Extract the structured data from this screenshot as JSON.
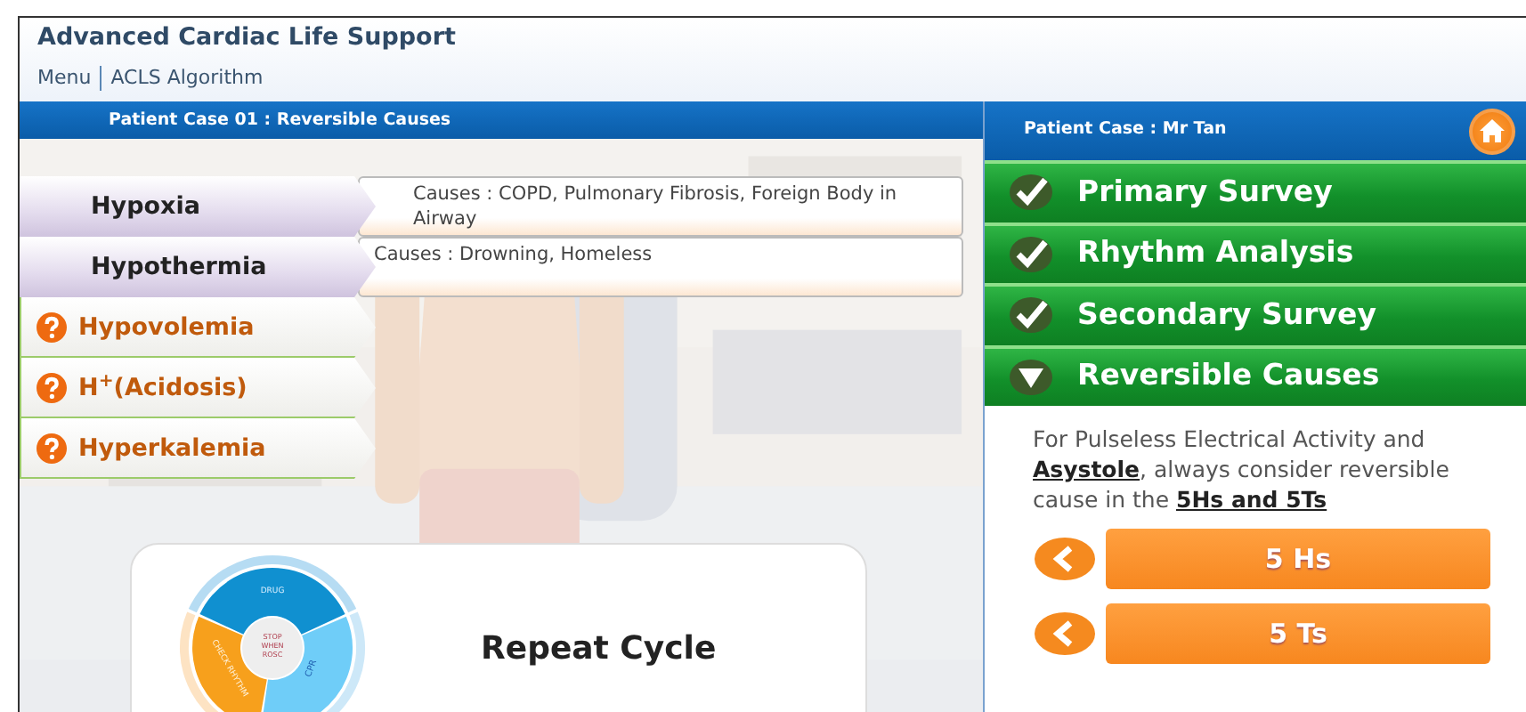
{
  "app": {
    "title": "Advanced Cardiac Life Support",
    "breadcrumb": [
      "Menu",
      "ACLS Algorithm"
    ]
  },
  "case_panel": {
    "title": "Patient Case 01 : Reversible Causes",
    "causes": [
      {
        "label": "Hypoxia",
        "revealed": true,
        "detail": "Causes : COPD, Pulmonary Fibrosis, Foreign Body in Airway"
      },
      {
        "label": "Hypothermia",
        "revealed": true,
        "detail": "Causes : Drowning, Homeless"
      },
      {
        "label": "Hypovolemia",
        "revealed": false
      },
      {
        "label": "H$^{+}$(Acidosis)",
        "revealed": false
      },
      {
        "label": "Hyperkalemia",
        "revealed": false
      }
    ],
    "cycle_card": {
      "title": "Repeat Cycle",
      "diagram_labels": [
        "DRUG",
        "STOP WHEN ROSC",
        "CHECK RHYTHM",
        "CPR"
      ]
    }
  },
  "side_panel": {
    "title": "Patient Case : Mr Tan",
    "steps": [
      {
        "label": "Primary Survey",
        "completed": true,
        "expanded": false
      },
      {
        "label": "Rhythm Analysis",
        "completed": true,
        "expanded": false
      },
      {
        "label": "Secondary Survey",
        "completed": true,
        "expanded": false
      },
      {
        "label": "Reversible Causes",
        "completed": false,
        "expanded": true
      }
    ],
    "note": "For Pulseless Electrical Activity and **Asystole**, always consider reversible cause in the **5Hs and 5Ts**",
    "buttons": [
      "5 Hs",
      "5 Ts"
    ]
  }
}
